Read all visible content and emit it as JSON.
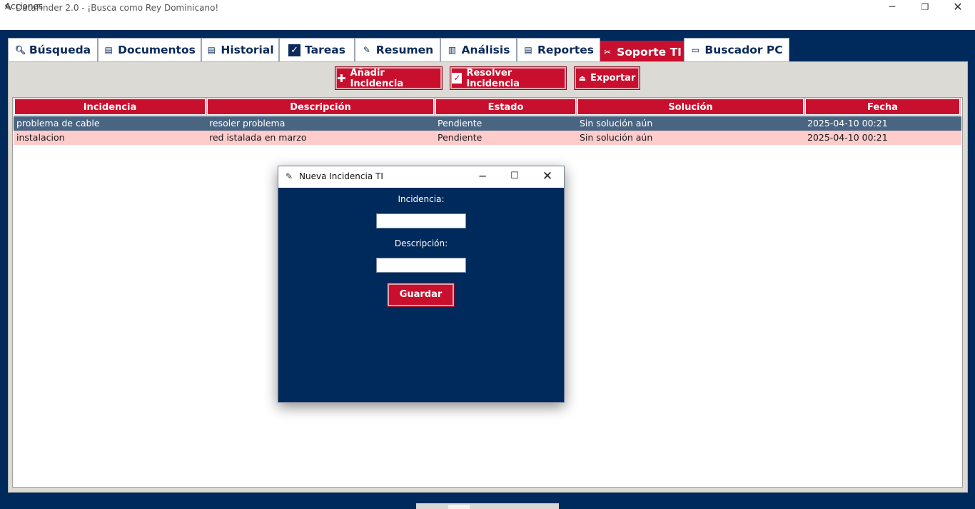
{
  "window": {
    "title": "DataFinder 2.0 - ¡Busca como Rey Dominicano!",
    "app_icon": "feather-icon"
  },
  "menu": {
    "items": [
      "Acciones"
    ]
  },
  "tabs": [
    {
      "label": "Búsqueda",
      "icon": "magnifier-icon"
    },
    {
      "label": "Documentos",
      "icon": "document-icon"
    },
    {
      "label": "Historial",
      "icon": "history-icon"
    },
    {
      "label": "Tareas",
      "icon": "checkbox-icon"
    },
    {
      "label": "Resumen",
      "icon": "memo-icon"
    },
    {
      "label": "Análisis",
      "icon": "bar-chart-icon"
    },
    {
      "label": "Reportes",
      "icon": "report-icon"
    },
    {
      "label": "Soporte TI",
      "icon": "tools-icon",
      "active": true
    },
    {
      "label": "Buscador PC",
      "icon": "laptop-icon"
    }
  ],
  "toolbar": {
    "add_label": "Añadir Incidencia",
    "resolve_label": "Resolver Incidencia",
    "export_label": "Exportar"
  },
  "table": {
    "columns": [
      "Incidencia",
      "Descripción",
      "Estado",
      "Solución",
      "Fecha"
    ],
    "rows": [
      [
        "problema de cable",
        "resoler problema",
        "Pendiente",
        "Sin solución aún",
        "2025-04-10 00:21"
      ],
      [
        "instalacion",
        "red istalada en marzo",
        "Pendiente",
        "Sin solución aún",
        "2025-04-10 00:21"
      ]
    ]
  },
  "dialog": {
    "title": "Nueva Incidencia TI",
    "incidencia_label": "Incidencia:",
    "incidencia_value": "",
    "descripcion_label": "Descripción:",
    "descripcion_value": "",
    "save_label": "Guardar"
  },
  "colors": {
    "accent": "#c8102e",
    "background": "#002a5c",
    "panel": "#dcdad5",
    "selected_row": "#4a6582",
    "alt_row": "#ffcccc"
  }
}
